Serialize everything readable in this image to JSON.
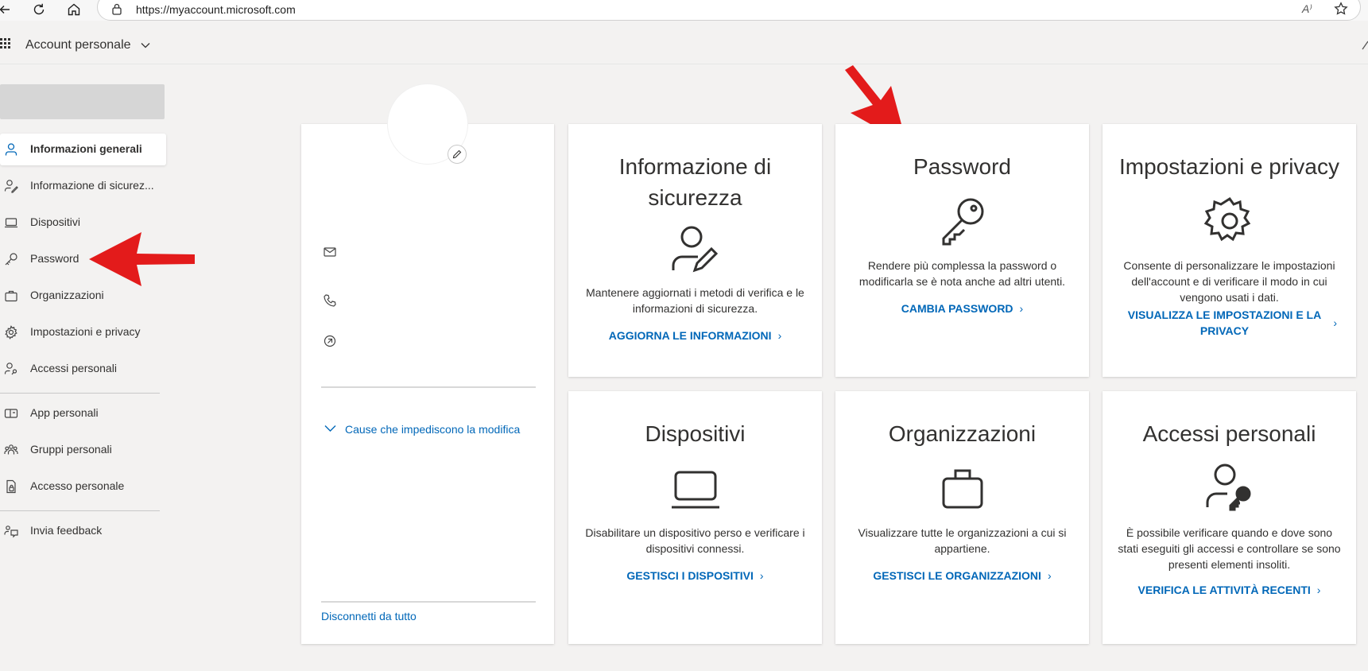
{
  "browser": {
    "url": "https://myaccount.microsoft.com",
    "read_aloud": "A⁾"
  },
  "header": {
    "title": "Account personale"
  },
  "sidebar": {
    "items": [
      {
        "label": "Informazioni generali",
        "icon": "person-icon",
        "active": true
      },
      {
        "label": "Informazione di sicurez...",
        "icon": "person-key-icon"
      },
      {
        "label": "Dispositivi",
        "icon": "laptop-icon"
      },
      {
        "label": "Password",
        "icon": "key-icon"
      },
      {
        "label": "Organizzazioni",
        "icon": "briefcase-icon"
      },
      {
        "label": "Impostazioni e privacy",
        "icon": "gear-icon"
      },
      {
        "label": "Accessi personali",
        "icon": "person-lock-icon"
      },
      {
        "label": "App personali",
        "icon": "apps-icon"
      },
      {
        "label": "Gruppi personali",
        "icon": "people-icon"
      },
      {
        "label": "Accesso personale",
        "icon": "lock-document-icon"
      },
      {
        "label": "Invia feedback",
        "icon": "feedback-icon"
      }
    ]
  },
  "profile_card": {
    "expand_label": "Cause che impediscono la modifica",
    "sign_out_label": "Disconnetti da tutto"
  },
  "tiles": [
    {
      "title": "Informazione di sicurezza",
      "icon": "person-edit-icon",
      "description": "Mantenere aggiornati i metodi di verifica e le informazioni di sicurezza.",
      "action": "AGGIORNA LE INFORMAZIONI"
    },
    {
      "title": "Password",
      "icon": "key-icon",
      "description": "Rendere più complessa la password o modificarla se è nota anche ad altri utenti.",
      "action": "CAMBIA PASSWORD"
    },
    {
      "title": "Impostazioni e privacy",
      "icon": "gear-icon",
      "description": "Consente di personalizzare le impostazioni dell'account e di verificare il modo in cui vengono usati i dati.",
      "action": "VISUALIZZA LE IMPOSTAZIONI E LA PRIVACY"
    },
    {
      "title": "Dispositivi",
      "icon": "laptop-icon",
      "description": "Disabilitare un dispositivo perso e verificare i dispositivi connessi.",
      "action": "GESTISCI I DISPOSITIVI"
    },
    {
      "title": "Organizzazioni",
      "icon": "briefcase-icon",
      "description": "Visualizzare tutte le organizzazioni a cui si appartiene.",
      "action": "GESTISCI LE ORGANIZZAZIONI"
    },
    {
      "title": "Accessi personali",
      "icon": "person-key-icon",
      "description": "È possibile verificare quando e dove sono stati eseguiti gli accessi e controllare se sono presenti elementi insoliti.",
      "action": "VERIFICA LE ATTIVITÀ RECENTI"
    }
  ],
  "colors": {
    "accent": "#0067b8",
    "arrow": "#e31b1b",
    "background": "#f3f2f1"
  }
}
